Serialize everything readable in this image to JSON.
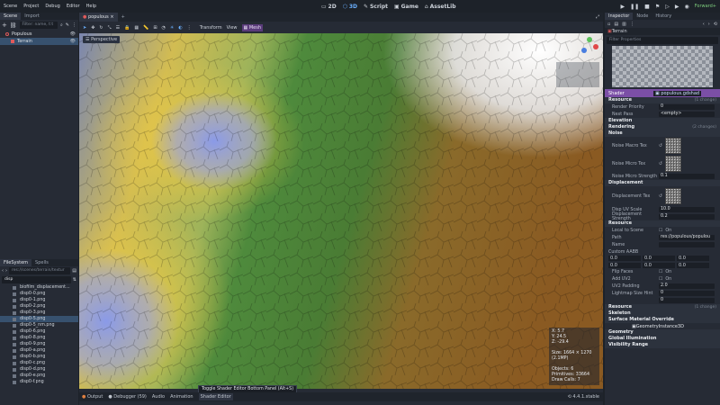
{
  "menus": [
    "Scene",
    "Project",
    "Debug",
    "Editor",
    "Help"
  ],
  "workspaces": [
    {
      "label": "2D",
      "icon": "2d-icon"
    },
    {
      "label": "3D",
      "icon": "3d-icon",
      "selected": true
    },
    {
      "label": "Script",
      "icon": "script-icon"
    },
    {
      "label": "Game",
      "icon": "game-icon"
    },
    {
      "label": "AssetLib",
      "icon": "assetlib-icon"
    }
  ],
  "renderer": "Forward+",
  "scene_dock": {
    "tabs": [
      "Scene",
      "Import"
    ],
    "filter_placeholder": "Filter: name, t:t",
    "nodes": [
      {
        "name": "Populous",
        "color": "#e05a5a"
      },
      {
        "name": "Terrain",
        "color": "#e05a5a",
        "selected": true
      }
    ]
  },
  "filesystem": {
    "tabs": [
      "FileSystem",
      "Spells"
    ],
    "path": "res://scenes/terrain/textur",
    "search": "disp",
    "files": [
      "biofilm_displacement...",
      "disp0-0.png",
      "disp0-1.png",
      "disp0-2.png",
      "disp0-3.png",
      "disp0-5.png",
      "disp0-5_nm.png",
      "disp0-6.png",
      "disp0-8.png",
      "disp0-9.png",
      "disp0-a.png",
      "disp0-b.png",
      "disp0-c.png",
      "disp0-d.png",
      "disp0-e.png",
      "disp0-f.png"
    ],
    "selected_index": 5
  },
  "editor_tab": "populous",
  "toolbar": {
    "menus": [
      "Transform",
      "View"
    ],
    "mesh_label": "Mesh"
  },
  "viewport": {
    "perspective_label": "Perspective",
    "stats": {
      "x": "X: 5.7",
      "y": "Y: 24.5",
      "z": "Z: -29.4",
      "size": "Size: 1664 × 1270 (2.1MP)",
      "objects": "Objects: 6",
      "primitives": "Primitives: 33664",
      "draw_calls": "Draw Calls: 7"
    }
  },
  "bottom_panel": {
    "tabs": [
      "Output",
      "Debugger (59)",
      "Audio",
      "Animation",
      "Shader Editor"
    ],
    "tooltip": "Toggle Shader Editor Bottom Panel (Alt+S)",
    "version": "4.4.1.stable"
  },
  "inspector": {
    "tabs": [
      "Inspector",
      "Node",
      "History"
    ],
    "node_name": "Terrain",
    "filter_placeholder": "Filter Properties",
    "shader_label": "Shader",
    "shader_value": "populous.gdshad",
    "sections": {
      "resource": "Resource",
      "changes": "(1 change)",
      "changes2": "(2 changes)",
      "render_priority": "Render Priority",
      "render_priority_val": "0",
      "next_pass": "Next Pass",
      "next_pass_val": "<empty>",
      "elevation": "Elevation",
      "rendering": "Rendering",
      "noise": "Noise",
      "noise_macro_tex": "Noise Macro Tex",
      "noise_micro_tex": "Noise Micro Tex",
      "noise_micro_strength": "Noise Micro Strength",
      "noise_micro_strength_val": "0.1",
      "displacement": "Displacement",
      "displacement_tex": "Displacement Tex",
      "disp_uv_scale": "Disp UV Scale",
      "disp_uv_scale_val": "10.0",
      "displacement_strength": "Displacement Strength",
      "displacement_strength_val": "0.2",
      "resource2": "Resource",
      "local_to_scene": "Local to Scene",
      "on": "On",
      "path": "Path",
      "path_val": "res://populous/populou",
      "name": "Name",
      "custom_aabb": "Custom AABB",
      "aabb": [
        "0.0",
        "0.0",
        "0.0",
        "0.0",
        "0.0",
        "0.0"
      ],
      "flip_faces": "Flip Faces",
      "add_uv2": "Add UV2",
      "uv2_padding": "UV2 Padding",
      "uv2_padding_val": "2.0",
      "lightmap_size_hint": "Lightmap Size Hint",
      "lightmap_x": "0",
      "lightmap_y": "0",
      "resource3": "Resource",
      "skeleton": "Skeleton",
      "surface_material_override": "Surface Material Override",
      "geometry_instance": "GeometryInstance3D",
      "geometry": "Geometry",
      "global_illumination": "Global Illumination",
      "visibility_range": "Visibility Range"
    }
  },
  "colors": {
    "accent": "#4a90d9",
    "selected": "#37516e",
    "panel": "#262b35",
    "shader_bar": "#7b4fa6"
  }
}
